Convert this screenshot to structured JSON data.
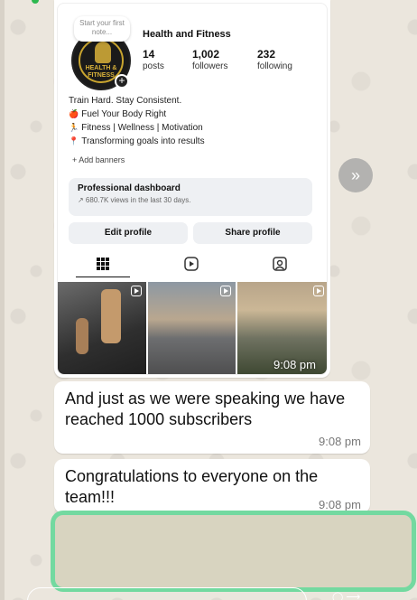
{
  "screenshot": {
    "note_placeholder": "Start your first note...",
    "profile_name": "Health and Fitness",
    "avatar_text": "HEALTH & FITNESS",
    "stats": [
      {
        "num": "14",
        "label": "posts"
      },
      {
        "num": "1,002",
        "label": "followers"
      },
      {
        "num": "232",
        "label": "following"
      }
    ],
    "bio": [
      {
        "emoji": "",
        "text": "Train Hard. Stay Consistent."
      },
      {
        "emoji": "🍎",
        "text": "Fuel Your Body Right"
      },
      {
        "emoji": "🏃",
        "text": "Fitness | Wellness | Motivation"
      },
      {
        "emoji": "📍",
        "text": "Transforming goals into results"
      }
    ],
    "add_banners": "+ Add banners",
    "dashboard_title": "Professional dashboard",
    "dashboard_sub": "↗ 680.7K views in the last 30 days.",
    "edit_profile": "Edit profile",
    "share_profile": "Share profile"
  },
  "image_time": "9:08 pm",
  "messages": [
    {
      "text": "And just as we were speaking we have reached 1000 subscribers",
      "time": "9:08 pm"
    },
    {
      "text": "Congratulations to everyone on the team!!!",
      "time": "9:08 pm"
    }
  ],
  "colors": {
    "chat_bg": "#ebe6dd",
    "highlight_border": "#73d9a0",
    "bubble": "#ffffff"
  },
  "icons": [
    "grid-icon",
    "reels-icon",
    "tagged-icon",
    "forward-icon",
    "reel-indicator-icon"
  ]
}
